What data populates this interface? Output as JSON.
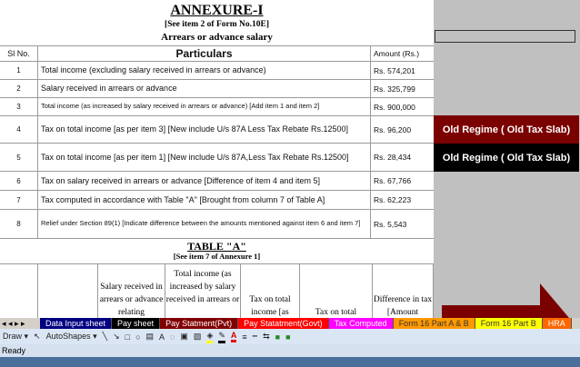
{
  "annexure": {
    "title": "ANNEXURE-I",
    "ref": "[See item 2 of Form No.10E]",
    "subtitle": "Arrears or advance salary"
  },
  "headers": {
    "sl": "Sl No.",
    "particulars": "Particulars",
    "amount": "Amount (Rs.)"
  },
  "rows": [
    {
      "sl": "1",
      "text": "Total income (excluding salary received in arrears or advance)",
      "amount": "Rs. 574,201"
    },
    {
      "sl": "2",
      "text": "Salary received in arrears or advance",
      "amount": "Rs. 325,799"
    },
    {
      "sl": "3",
      "text": "Total income (as increased by salary received in arrears or advance)  [Add item 1 and item 2]",
      "amount": "Rs. 900,000"
    },
    {
      "sl": "4",
      "text": "Tax on total income [as per item 3] [New include U/s 87A Less Tax Rebate Rs.12500]",
      "amount": "Rs. 96,200"
    },
    {
      "sl": "5",
      "text": "Tax on total income [as per item 1] [New include U/s 87A,Less Tax Rebate Rs.12500]",
      "amount": "Rs. 28,434"
    },
    {
      "sl": "6",
      "text": "Tax on salary received in arrears or advance [Difference of item 4 and item 5]",
      "amount": "Rs. 67,766"
    },
    {
      "sl": "7",
      "text": "Tax computed in accordance with Table \"A\" [Brought from column 7 of Table A]",
      "amount": "Rs. 62,223"
    },
    {
      "sl": "8",
      "text": "Relief under Section 89(1) [Indicate difference between the amounts mentioned against item 6 and item 7]",
      "amount": "Rs. 5,543"
    }
  ],
  "tableA": {
    "title": "TABLE \"A\"",
    "ref": "[See item 7 of Annexure 1]",
    "columns": [
      "",
      "",
      "Salary received in arrears or advance relating",
      "Total income (as increased by salary received in arrears or",
      "Tax on total income  [as",
      "Tax on total",
      "Difference in tax [Amount"
    ]
  },
  "regime": [
    {
      "label": "Old Regime ( Old Tax Slab)",
      "color": "#7b0000"
    },
    {
      "label": "Old Regime ( Old Tax Slab)",
      "color": "#000000"
    }
  ],
  "sheet_tabs": [
    {
      "label": "Data Input sheet",
      "bg": "#000080",
      "fg": "#ffffff"
    },
    {
      "label": "Pay sheet",
      "bg": "#000000",
      "fg": "#ffffff"
    },
    {
      "label": "Pay Statment(Pvt)",
      "bg": "#800000",
      "fg": "#ffffff"
    },
    {
      "label": "Pay Statatment(Govt)",
      "bg": "#ff0000",
      "fg": "#ffffff"
    },
    {
      "label": "Tax Computed",
      "bg": "#ff00ff",
      "fg": "#ffffff"
    },
    {
      "label": "Form 16 Part A & B",
      "bg": "#ff9900",
      "fg": "#333333"
    },
    {
      "label": "Form 16 Part B",
      "bg": "#ffff00",
      "fg": "#333333"
    },
    {
      "label": "HRA",
      "bg": "#ff6600",
      "fg": "#ffffff"
    }
  ],
  "toolbar": {
    "draw": "Draw",
    "autoshapes": "AutoShapes"
  },
  "status": "Ready"
}
